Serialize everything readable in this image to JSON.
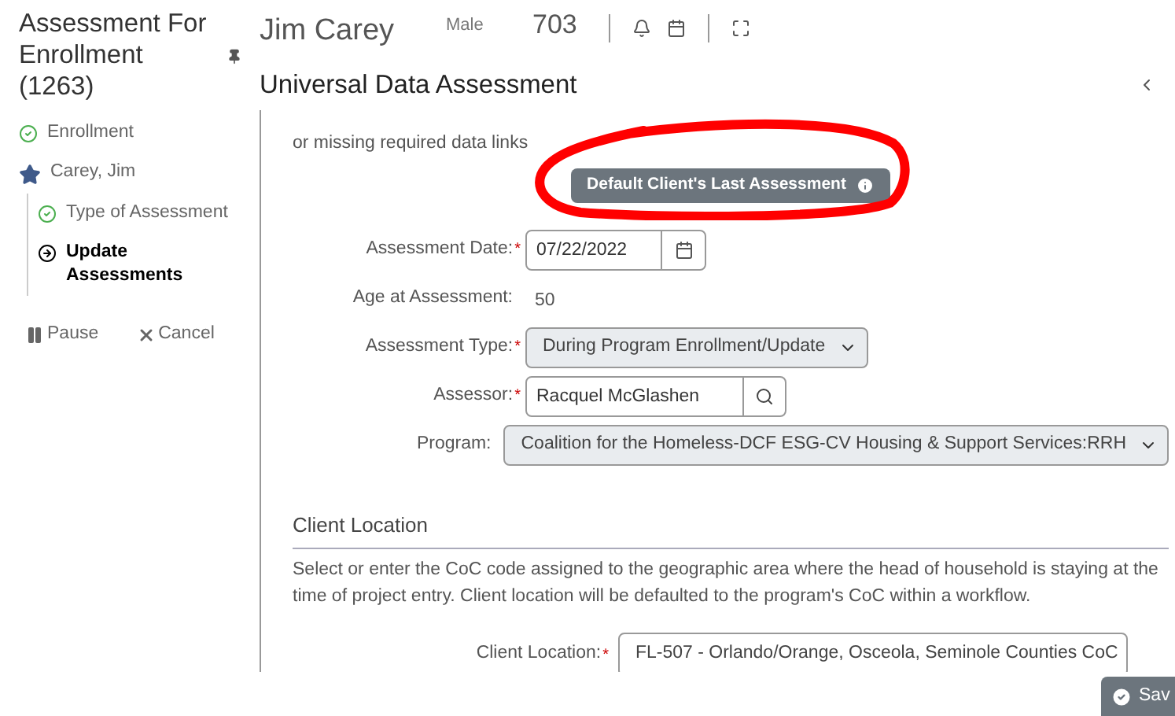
{
  "page_title": "Assessment For Enrollment (1263)",
  "client": {
    "name": "Jim Carey",
    "gender": "Male",
    "id": "703"
  },
  "sidebar": {
    "steps": [
      {
        "label": "Enrollment",
        "kind": "done"
      },
      {
        "label": "Carey, Jim",
        "kind": "client",
        "children": [
          {
            "label": "Type of Assessment",
            "kind": "done"
          },
          {
            "label": "Update Assessments",
            "kind": "current"
          }
        ]
      }
    ],
    "actions": [
      {
        "label": "Pause",
        "kind": "pause"
      },
      {
        "label": "Cancel",
        "kind": "cancel"
      }
    ]
  },
  "assessment_title": "Universal Data Assessment",
  "notice": "or missing required data links",
  "default_button": "Default Client's Last Assessment",
  "fields": [
    {
      "label": "Assessment Date:",
      "required_mark": "*",
      "kind": "date",
      "value": "07/22/2022"
    },
    {
      "label": "Age at Assessment:",
      "kind": "static",
      "value": "50"
    },
    {
      "label": "Assessment Type:",
      "required_mark": "*",
      "kind": "select",
      "value": "During Program Enrollment/Update"
    },
    {
      "label": "Assessor:",
      "required_mark": "*",
      "kind": "search",
      "value": "Racquel McGlashen"
    },
    {
      "label": "Program:",
      "kind": "select",
      "value": "Coalition for the Homeless-DCF ESG-CV Housing & Support Services:RRH"
    }
  ],
  "client_location": {
    "heading": "Client Location",
    "description": "Select or enter the CoC code assigned to the geographic area where the head of household is staying at the time of project entry. Client location will be defaulted to the program's CoC within a workflow.",
    "label": "Client Location:",
    "required_mark": "*",
    "value": "FL-507 - Orlando/Orange, Osceola, Seminole Counties CoC"
  },
  "save_button": "Sav"
}
